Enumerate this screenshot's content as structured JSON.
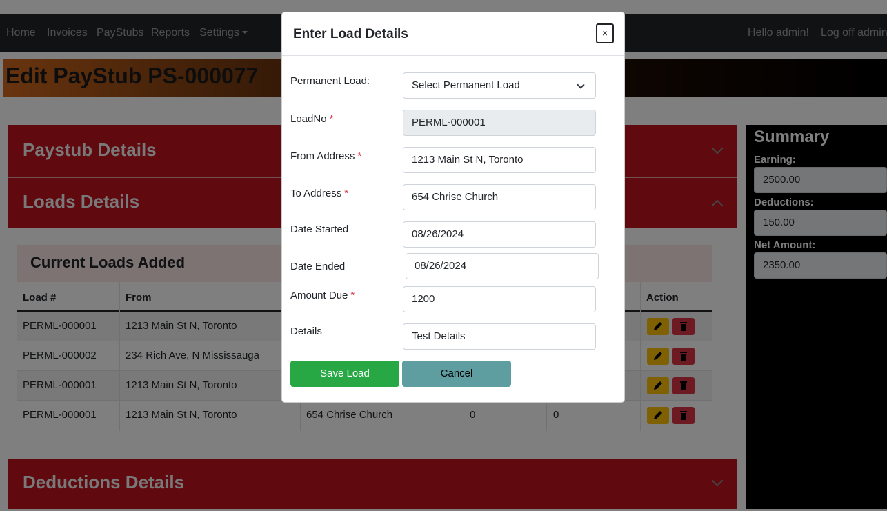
{
  "nav": {
    "items": [
      {
        "label": "Home"
      },
      {
        "label": "Invoices"
      },
      {
        "label": "PayStubs"
      },
      {
        "label": "Reports"
      },
      {
        "label": "Settings"
      }
    ],
    "greeting": "Hello admin!",
    "logoff": "Log off admin"
  },
  "page": {
    "title": "Edit PayStub PS-000077"
  },
  "sections": {
    "paystub": "Paystub Details",
    "loads": "Loads Details",
    "deductions": "Deductions Details"
  },
  "loads_table": {
    "heading": "Current Loads Added",
    "columns": [
      "Load #",
      "From",
      "Action"
    ],
    "rows": [
      {
        "load": "PERML-000001",
        "from": "1213 Main St N, Toronto",
        "to": "",
        "c4": "",
        "c5": ""
      },
      {
        "load": "PERML-000002",
        "from": "234 Rich Ave, N Mississauga",
        "to": "",
        "c4": "",
        "c5": ""
      },
      {
        "load": "PERML-000001",
        "from": "1213 Main St N, Toronto",
        "to": "",
        "c4": "",
        "c5": ""
      },
      {
        "load": "PERML-000001",
        "from": "1213 Main St N, Toronto",
        "to": "654 Chrise Church",
        "c4": "0",
        "c5": "0"
      }
    ]
  },
  "summary": {
    "title": "Summary",
    "earning_label": "Earning:",
    "earning": "2500.00",
    "deductions_label": "Deductions:",
    "deductions": "150.00",
    "net_label": "Net Amount:",
    "net": "2350.00"
  },
  "modal": {
    "title": "Enter Load Details",
    "close": "×",
    "fields": {
      "permanent_load": {
        "label": "Permanent Load:",
        "value": "Select Permanent Load"
      },
      "load_no": {
        "label": "LoadNo",
        "required": "*",
        "value": "PERML-000001"
      },
      "from_address": {
        "label": "From Address",
        "required": "*",
        "value": "1213 Main St N, Toronto"
      },
      "to_address": {
        "label": "To Address",
        "required": "*",
        "value": "654 Chrise Church"
      },
      "date_started": {
        "label": "Date Started",
        "value": "08/26/2024"
      },
      "date_ended": {
        "label": "Date Ended",
        "value": "08/26/2024"
      },
      "amount_due": {
        "label": "Amount Due",
        "required": "*",
        "value": "1200"
      },
      "details": {
        "label": "Details",
        "value": "Test Details"
      }
    },
    "save": "Save Load",
    "cancel": "Cancel"
  },
  "colors": {
    "navbar": "#212529",
    "accordion": "#c1121f",
    "save": "#28a745",
    "cancel": "#5f9ea0",
    "required": "#dc3545"
  }
}
